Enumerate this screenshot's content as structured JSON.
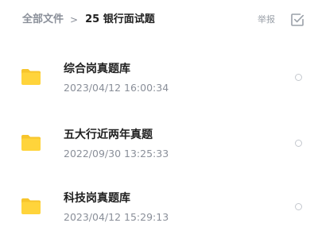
{
  "breadcrumb": {
    "root": "全部文件",
    "separator": ">",
    "current": "25 银行面试题"
  },
  "header": {
    "report_label": "举报",
    "select_icon": "checkbox-icon"
  },
  "colors": {
    "folder": "#FFD43B",
    "folder_tab": "#F7C52C",
    "muted_text": "#8A8F99"
  },
  "files": [
    {
      "name": "综合岗真题库",
      "date": "2023/04/12 16:00:34",
      "icon": "folder-icon"
    },
    {
      "name": "五大行近两年真题",
      "date": "2022/09/30 13:25:33",
      "icon": "folder-icon"
    },
    {
      "name": "科技岗真题库",
      "date": "2023/04/12 15:29:13",
      "icon": "folder-icon"
    }
  ]
}
